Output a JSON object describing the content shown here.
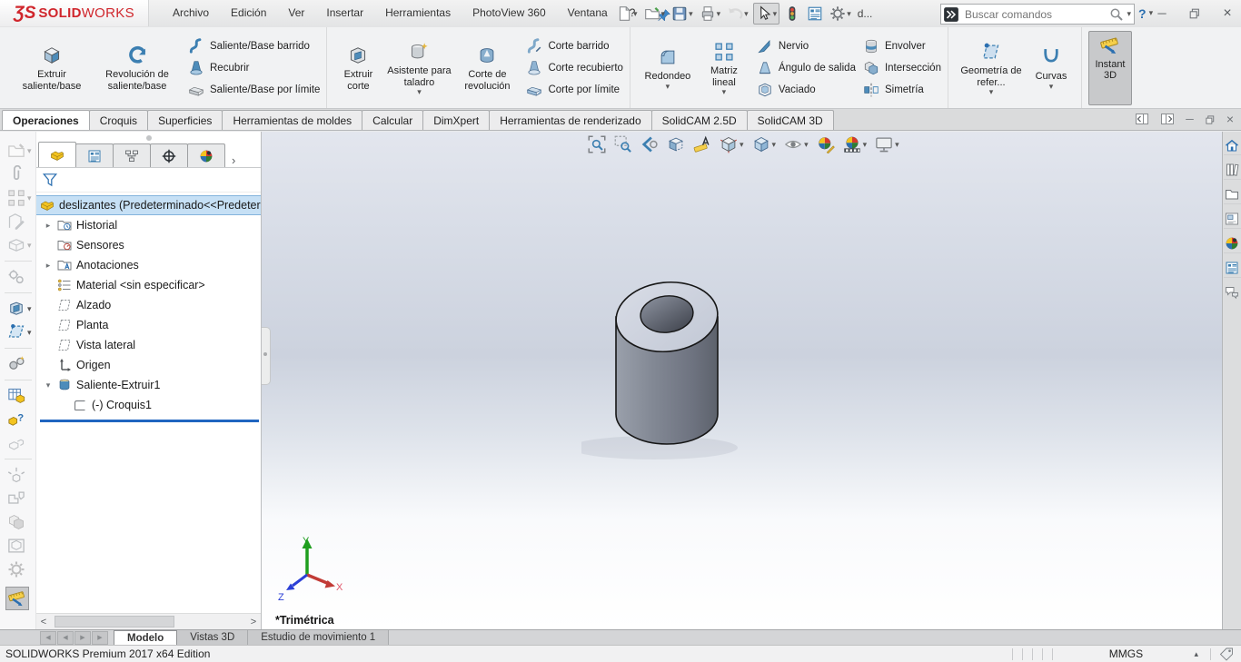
{
  "titlebar": {
    "logo": {
      "mark": "ƷS",
      "brand_bold": "SOLID",
      "brand_light": "WORKS"
    },
    "menus": [
      "Archivo",
      "Edición",
      "Ver",
      "Insertar",
      "Herramientas",
      "PhotoView 360",
      "Ventana",
      "?"
    ],
    "doc_short": "d...",
    "search_placeholder": "Buscar comandos",
    "help_label": "?"
  },
  "ribbon": {
    "groups": [
      {
        "big": [
          {
            "label": "Extruir saliente/base"
          },
          {
            "label": "Revolución de saliente/base"
          }
        ],
        "small": [
          {
            "label": "Saliente/Base barrido"
          },
          {
            "label": "Recubrir"
          },
          {
            "label": "Saliente/Base por límite"
          }
        ]
      },
      {
        "big": [
          {
            "label": "Extruir corte"
          },
          {
            "label": "Asistente para taladro"
          },
          {
            "label": "Corte de revolución"
          }
        ],
        "small": [
          {
            "label": "Corte barrido"
          },
          {
            "label": "Corte recubierto"
          },
          {
            "label": "Corte por límite"
          }
        ]
      },
      {
        "big": [
          {
            "label": "Redondeo"
          },
          {
            "label": "Matriz lineal"
          }
        ],
        "small": [
          {
            "label": "Nervio"
          },
          {
            "label": "Ángulo de salida"
          },
          {
            "label": "Vaciado"
          }
        ],
        "small2": [
          {
            "label": "Envolver"
          },
          {
            "label": "Intersección"
          },
          {
            "label": "Simetría"
          }
        ]
      },
      {
        "big": [
          {
            "label": "Geometría de refer..."
          },
          {
            "label": "Curvas"
          }
        ]
      },
      {
        "big": [
          {
            "label": "Instant 3D"
          }
        ]
      }
    ]
  },
  "command_tabs": {
    "items": [
      {
        "label": "Operaciones"
      },
      {
        "label": "Croquis"
      },
      {
        "label": "Superficies"
      },
      {
        "label": "Herramientas de moldes"
      },
      {
        "label": "Calcular"
      },
      {
        "label": "DimXpert"
      },
      {
        "label": "Herramientas de renderizado"
      },
      {
        "label": "SolidCAM 2.5D"
      },
      {
        "label": "SolidCAM 3D"
      }
    ]
  },
  "feature_tree": {
    "root_label": "deslizantes (Predeterminado<<Predeter",
    "items": [
      {
        "label": "Historial"
      },
      {
        "label": "Sensores"
      },
      {
        "label": "Anotaciones"
      },
      {
        "label": "Material <sin especificar>"
      },
      {
        "label": "Alzado"
      },
      {
        "label": "Planta"
      },
      {
        "label": "Vista lateral"
      },
      {
        "label": "Origen"
      },
      {
        "label": "Saliente-Extruir1"
      },
      {
        "label": "(-) Croquis1"
      }
    ]
  },
  "viewport": {
    "orientation_label": "*Trimétrica",
    "axes": {
      "x": "X",
      "y": "Y",
      "z": "Z"
    }
  },
  "bottom_tabs": {
    "items": [
      {
        "label": "Modelo"
      },
      {
        "label": "Vistas 3D"
      },
      {
        "label": "Estudio de movimiento 1"
      }
    ]
  },
  "statusbar": {
    "left": "SOLIDWORKS Premium 2017 x64 Edition",
    "units": "MMGS"
  },
  "glyphs": {
    "chevron_down": "▾",
    "collapsed": "▸",
    "expanded": "▾",
    "panel_expand": "›",
    "minimize": "─",
    "close": "×",
    "scroll_left": "<",
    "scroll_right": ">",
    "nav_first": "◀",
    "nav_prev": "◀",
    "nav_next": "▶",
    "nav_last": "▶",
    "units_dropdown": "▴"
  },
  "colors": {
    "brand_red": "#d0262c",
    "accent_blue": "#2b6fb0",
    "selection_bg": "#c6e0f5",
    "rollback_blue": "#2065c0"
  }
}
